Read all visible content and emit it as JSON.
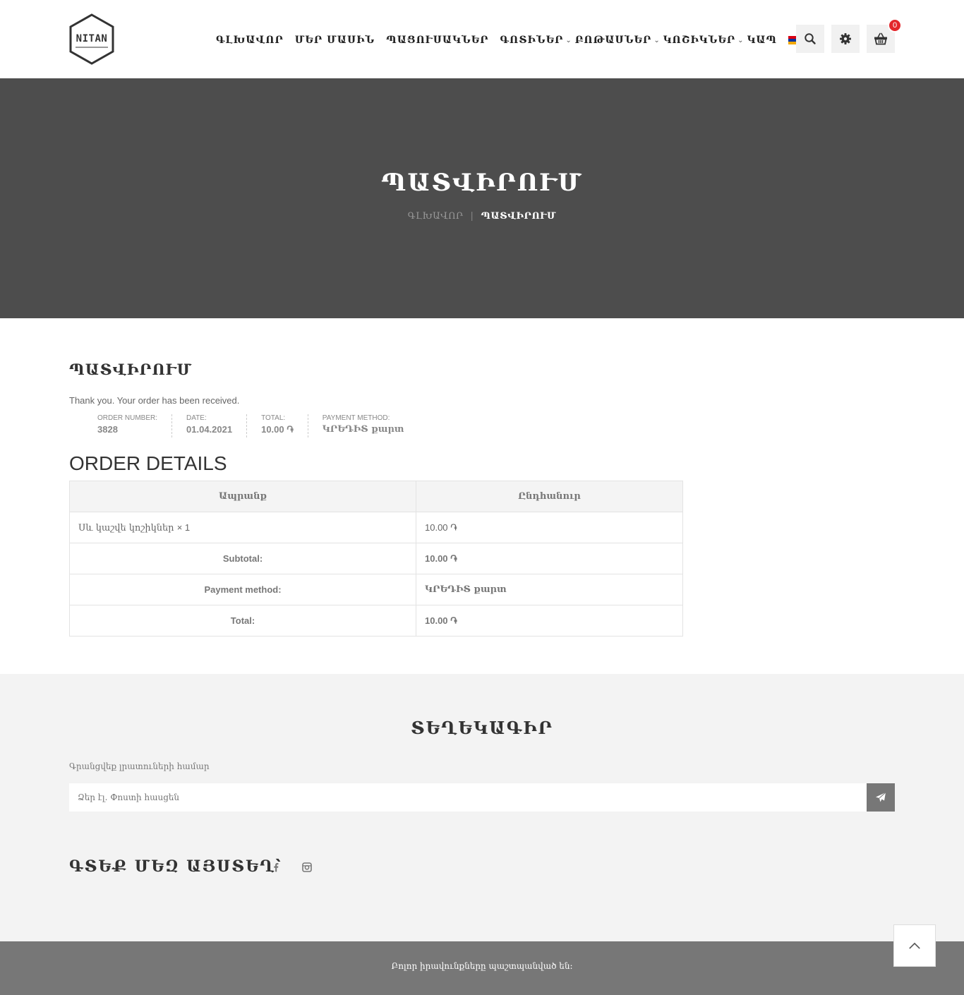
{
  "header": {
    "logo_text": "NITAN",
    "nav": [
      {
        "label": "ԳԼԽԱՎՈՐ",
        "dropdown": false
      },
      {
        "label": "ՄԵՐ ՄԱՍԻՆ",
        "dropdown": false
      },
      {
        "label": "ՊԱՑՈՒՍԱԿՆԵՐ",
        "dropdown": false
      },
      {
        "label": "ԳՈՏԻՆԵՐ",
        "dropdown": true
      },
      {
        "label": "ԲՈԹԱՍՆԵՐ",
        "dropdown": true
      },
      {
        "label": "ԿՈՇԻԿՆԵՐ",
        "dropdown": true
      },
      {
        "label": "ԿԱՊ",
        "dropdown": false
      }
    ],
    "cart_count": "0",
    "flag_colors": [
      "#d90012",
      "#0033a0",
      "#f2a800"
    ]
  },
  "hero": {
    "title": "ՊԱՏՎԻՐՈՒՄ",
    "breadcrumb_home": "ԳԼԽԱՎՈՐ",
    "breadcrumb_current": "ՊԱՏՎԻՐՈՒՄ"
  },
  "order": {
    "heading": "ՊԱՏՎԻՐՈՒՄ",
    "thanks": "Thank you. Your order has been received.",
    "overview": [
      {
        "label": "ORDER NUMBER:",
        "value": "3828"
      },
      {
        "label": "DATE:",
        "value": "01.04.2021"
      },
      {
        "label": "TOTAL:",
        "value": "10.00 ֏"
      },
      {
        "label": "PAYMENT METHOD:",
        "value": "ԿՐԵԴԻՏ քարտ"
      }
    ],
    "details_title": "ORDER DETAILS",
    "table": {
      "headers": [
        "Ապրանք",
        "Ընդհանուր"
      ],
      "item_name": "Սև կաշվե կոշիկներ",
      "item_qty": "× 1",
      "item_total": "10.00 ֏",
      "rows": [
        {
          "label": "Subtotal:",
          "value": "10.00 ֏"
        },
        {
          "label": "Payment method:",
          "value": "ԿՐԵԴԻՏ քարտ"
        },
        {
          "label": "Total:",
          "value": "10.00 ֏"
        }
      ]
    }
  },
  "newsletter": {
    "title": "ՏԵՂԵԿԱԳԻՐ",
    "label": "Գրանցվեք լրատուների համար",
    "placeholder": "Ձեր էլ. Փոստի հասցեն",
    "find_us": "ԳՏԵՔ ՄԵԶ ԱՅՍՏԵՂ՝"
  },
  "footer": {
    "text": "Բոլոր իրավունքները պաշտպանված են:"
  },
  "colors": {
    "hero_bg": "#4d4d4d",
    "footer_bg": "#777777",
    "badge": "#e3262b"
  }
}
